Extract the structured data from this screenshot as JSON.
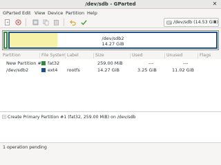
{
  "window": {
    "title": "/dev/sdb - GParted"
  },
  "menu": [
    "GParted",
    "Edit",
    "View",
    "Device",
    "Partition",
    "Help"
  ],
  "toolbar": {
    "buttons": [
      "new-icon",
      "delete-icon",
      "resize-move-icon",
      "copy-icon",
      "paste-icon",
      "undo-icon",
      "apply-icon"
    ],
    "device_selector": "/dev/sdb  (14.53 GiB)"
  },
  "disk_map": {
    "partition_name": "/dev/sdb2",
    "partition_size": "14.27 GiB",
    "used_fraction": 0.23,
    "colors": {
      "fat32": "#2e8b3a",
      "ext4": "#1f4f87",
      "used": "#f6f3a8"
    }
  },
  "table": {
    "columns": [
      "Partition",
      "File System",
      "Label",
      "Size",
      "Used",
      "Unused",
      "Flags"
    ],
    "rows": [
      {
        "partition": "New Partition #1",
        "filesystem": "fat32",
        "fs_color": "#2e8b3a",
        "label": "",
        "size": "259.00 MiB",
        "used": "---",
        "unused": "---",
        "flags": ""
      },
      {
        "partition": "/dev/sdb2",
        "filesystem": "ext4",
        "fs_color": "#1f4f87",
        "label": "rootfs",
        "size": "14.27 GiB",
        "used": "3.25 GiB",
        "unused": "11.02 GiB",
        "flags": ""
      }
    ]
  },
  "pending": {
    "operations": [
      "Create Primary Partition #1 (fat32, 259.00 MiB) on /dev/sdb"
    ]
  },
  "status": {
    "text": "1 operation pending"
  }
}
